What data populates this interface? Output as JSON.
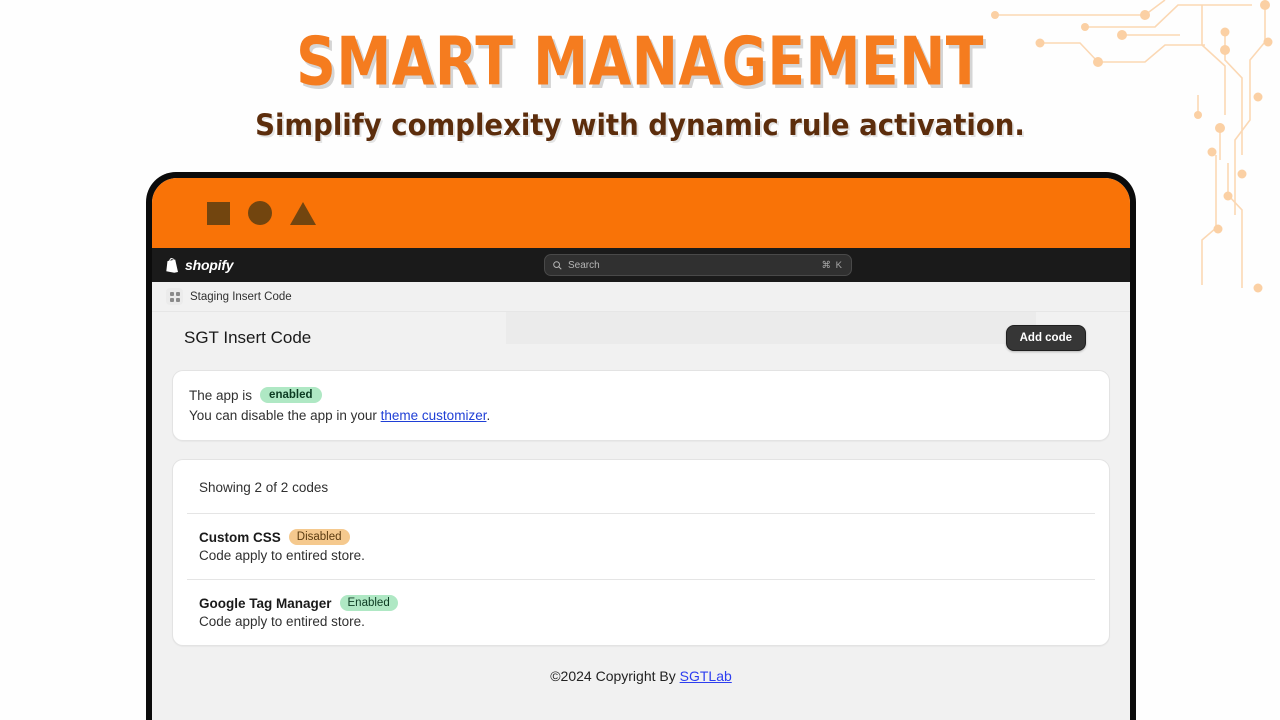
{
  "hero": {
    "title": "SMART MANAGEMENT",
    "subtitle": "Simplify complexity with dynamic rule activation.",
    "title_color": "#F57C1F",
    "subtitle_color": "#5C2D0C"
  },
  "browser_chrome": {
    "background_color": "#F97307",
    "shape_color": "#72450F",
    "shapes": [
      "square-shape",
      "circle-shape",
      "triangle-shape"
    ]
  },
  "topbar": {
    "brand": "shopify",
    "brand_icon": "shopify-bag-icon",
    "background_color": "#1a1a1a",
    "search": {
      "icon": "search-icon",
      "placeholder": "Search",
      "shortcut": "⌘ K"
    }
  },
  "breadcrumb": {
    "icon": "app-grid-icon",
    "label": "Staging Insert Code"
  },
  "page": {
    "title": "SGT Insert Code",
    "primary_action": "Add code"
  },
  "status_card": {
    "prefix": "The app is",
    "state_badge": "enabled",
    "state_badge_color": "#AFE8C4",
    "line2_prefix": "You can disable the app in your ",
    "line2_link": "theme customizer",
    "line2_suffix": ".",
    "link_color": "#1f3fd6"
  },
  "codes_card": {
    "showing": "Showing 2 of 2 codes",
    "items": [
      {
        "name": "Custom CSS",
        "badge": "Disabled",
        "badge_color": "#F5C98E",
        "description": "Code apply to entired store."
      },
      {
        "name": "Google Tag Manager",
        "badge": "Enabled",
        "badge_color": "#AFE8C4",
        "description": "Code apply to entired store."
      }
    ]
  },
  "footer": {
    "text": "©2024 Copyright By ",
    "link": "SGTLab",
    "link_color": "#2d3ef0"
  }
}
